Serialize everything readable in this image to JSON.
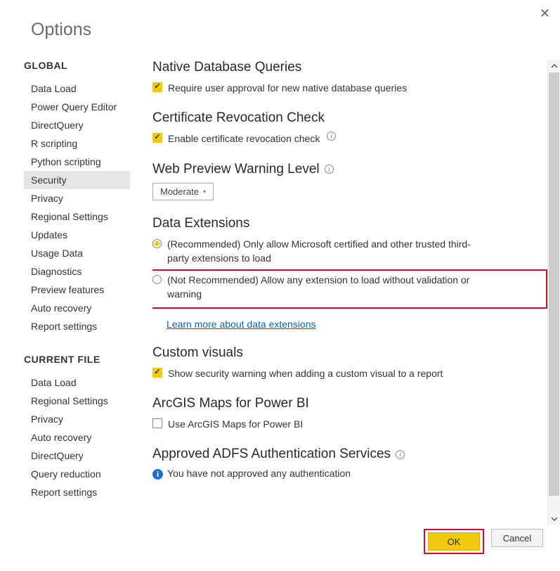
{
  "dialog": {
    "title": "Options"
  },
  "sidebar": {
    "sections": [
      {
        "header": "GLOBAL",
        "items": [
          {
            "label": "Data Load",
            "selected": false
          },
          {
            "label": "Power Query Editor",
            "selected": false
          },
          {
            "label": "DirectQuery",
            "selected": false
          },
          {
            "label": "R scripting",
            "selected": false
          },
          {
            "label": "Python scripting",
            "selected": false
          },
          {
            "label": "Security",
            "selected": true
          },
          {
            "label": "Privacy",
            "selected": false
          },
          {
            "label": "Regional Settings",
            "selected": false
          },
          {
            "label": "Updates",
            "selected": false
          },
          {
            "label": "Usage Data",
            "selected": false
          },
          {
            "label": "Diagnostics",
            "selected": false
          },
          {
            "label": "Preview features",
            "selected": false
          },
          {
            "label": "Auto recovery",
            "selected": false
          },
          {
            "label": "Report settings",
            "selected": false
          }
        ]
      },
      {
        "header": "CURRENT FILE",
        "items": [
          {
            "label": "Data Load",
            "selected": false
          },
          {
            "label": "Regional Settings",
            "selected": false
          },
          {
            "label": "Privacy",
            "selected": false
          },
          {
            "label": "Auto recovery",
            "selected": false
          },
          {
            "label": "DirectQuery",
            "selected": false
          },
          {
            "label": "Query reduction",
            "selected": false
          },
          {
            "label": "Report settings",
            "selected": false
          }
        ]
      }
    ]
  },
  "main": {
    "native_db": {
      "title": "Native Database Queries",
      "check_label": "Require user approval for new native database queries",
      "checked": true
    },
    "cert_revocation": {
      "title": "Certificate Revocation Check",
      "check_label": "Enable certificate revocation check",
      "checked": true
    },
    "web_preview": {
      "title": "Web Preview Warning Level",
      "value": "Moderate"
    },
    "data_extensions": {
      "title": "Data Extensions",
      "option_recommended": "(Recommended) Only allow Microsoft certified and other trusted third-party extensions to load",
      "option_not_recommended": "(Not Recommended) Allow any extension to load without validation or warning",
      "selected": "recommended",
      "learn_more": "Learn more about data extensions"
    },
    "custom_visuals": {
      "title": "Custom visuals",
      "check_label": "Show security warning when adding a custom visual to a report",
      "checked": true
    },
    "arcgis": {
      "title": "ArcGIS Maps for Power BI",
      "check_label": "Use ArcGIS Maps for Power BI",
      "checked": false
    },
    "adfs": {
      "title": "Approved ADFS Authentication Services",
      "info_text": "You have not approved any authentication"
    }
  },
  "footer": {
    "ok": "OK",
    "cancel": "Cancel"
  }
}
